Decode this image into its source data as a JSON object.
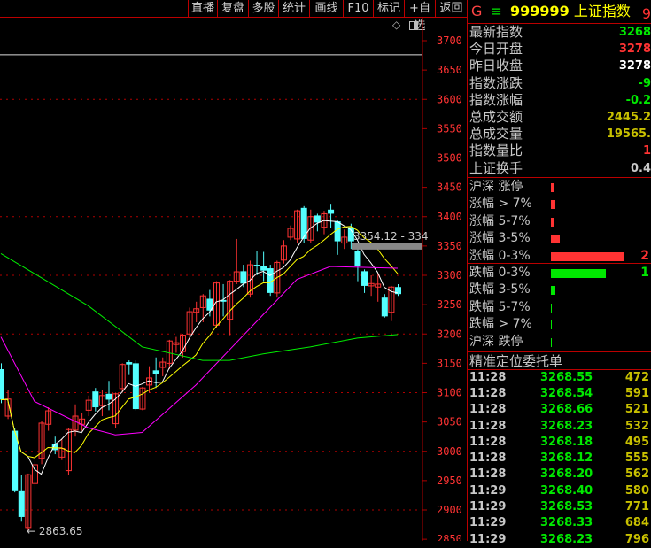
{
  "toolbar": {
    "buttons": [
      "直播",
      "复盘",
      "多股",
      "统计",
      "画线",
      "F10",
      "标记",
      "+自选",
      "返回"
    ]
  },
  "chart": {
    "price_axis": [
      "3700",
      "3650",
      "3600",
      "3550",
      "3500",
      "3450",
      "3400",
      "3350",
      "3300",
      "3250",
      "3200",
      "3150",
      "3100",
      "3050",
      "3000",
      "2950",
      "2900",
      "2850"
    ],
    "low_label": "2863.65",
    "range_label": "3354.12 - 334",
    "hline_price": 3676,
    "band_price": 3350,
    "colors": {
      "up": "#ff3333",
      "down": "#54ffff",
      "ma5": "#ffffff",
      "ma10": "#ffff00",
      "ma20": "#ff00ff",
      "ma60": "#00ee00",
      "grid": "#b00000"
    },
    "candles": [
      [
        3140,
        3150,
        3082,
        3088
      ],
      [
        3060,
        3105,
        3055,
        3089
      ],
      [
        3035,
        3040,
        2930,
        2932
      ],
      [
        2932,
        2960,
        2880,
        2888
      ],
      [
        2870,
        2962,
        2864,
        2960
      ],
      [
        2945,
        2985,
        2935,
        2977
      ],
      [
        2988,
        3052,
        2978,
        3048
      ],
      [
        3046,
        3075,
        3035,
        3069
      ],
      [
        3013,
        3025,
        2995,
        3002
      ],
      [
        2990,
        3020,
        2985,
        3005
      ],
      [
        2967,
        3040,
        2960,
        3037
      ],
      [
        3036,
        3080,
        3025,
        3060
      ],
      [
        3046,
        3065,
        3035,
        3055
      ],
      [
        3070,
        3095,
        3060,
        3087
      ],
      [
        3102,
        3108,
        3068,
        3075
      ],
      [
        3078,
        3105,
        3060,
        3095
      ],
      [
        3098,
        3120,
        3070,
        3088
      ],
      [
        3047,
        3100,
        3040,
        3098
      ],
      [
        3107,
        3150,
        3100,
        3148
      ],
      [
        3152,
        3155,
        3130,
        3148
      ],
      [
        3150,
        3155,
        3070,
        3072
      ],
      [
        3072,
        3110,
        3070,
        3108
      ],
      [
        3113,
        3145,
        3100,
        3125
      ],
      [
        3138,
        3160,
        3108,
        3132
      ],
      [
        3143,
        3160,
        3128,
        3152
      ],
      [
        3150,
        3190,
        3140,
        3188
      ],
      [
        3182,
        3195,
        3168,
        3185
      ],
      [
        3170,
        3200,
        3160,
        3198
      ],
      [
        3200,
        3245,
        3190,
        3238
      ],
      [
        3237,
        3255,
        3220,
        3243
      ],
      [
        3245,
        3268,
        3220,
        3265
      ],
      [
        3260,
        3275,
        3230,
        3240
      ],
      [
        3215,
        3290,
        3210,
        3287
      ],
      [
        3258,
        3285,
        3230,
        3255
      ],
      [
        3225,
        3292,
        3198,
        3290
      ],
      [
        3290,
        3362,
        3285,
        3306
      ],
      [
        3307,
        3318,
        3280,
        3286
      ],
      [
        3268,
        3325,
        3262,
        3318
      ],
      [
        3318,
        3342,
        3300,
        3316
      ],
      [
        3316,
        3340,
        3290,
        3308
      ],
      [
        3312,
        3318,
        3265,
        3270
      ],
      [
        3270,
        3325,
        3262,
        3322
      ],
      [
        3326,
        3360,
        3320,
        3350
      ],
      [
        3365,
        3385,
        3360,
        3380
      ],
      [
        3362,
        3412,
        3355,
        3410
      ],
      [
        3415,
        3418,
        3355,
        3362
      ],
      [
        3360,
        3412,
        3355,
        3400
      ],
      [
        3402,
        3405,
        3375,
        3390
      ],
      [
        3382,
        3410,
        3370,
        3405
      ],
      [
        3412,
        3422,
        3380,
        3405
      ],
      [
        3392,
        3395,
        3335,
        3358
      ],
      [
        3355,
        3378,
        3345,
        3365
      ],
      [
        3382,
        3388,
        3345,
        3358
      ],
      [
        3342,
        3345,
        3290,
        3316
      ],
      [
        3307,
        3310,
        3270,
        3282
      ],
      [
        3282,
        3300,
        3265,
        3286
      ],
      [
        3280,
        3302,
        3255,
        3285
      ],
      [
        3262,
        3268,
        3228,
        3230
      ],
      [
        3237,
        3282,
        3222,
        3280
      ],
      [
        3280,
        3285,
        3265,
        3268
      ]
    ],
    "ma20_points": [
      [
        0,
        3195
      ],
      [
        5,
        3085
      ],
      [
        13,
        3040
      ],
      [
        17,
        3028
      ],
      [
        21,
        3032
      ],
      [
        29,
        3113
      ],
      [
        39,
        3233
      ],
      [
        44,
        3293
      ],
      [
        49,
        3315
      ],
      [
        59,
        3312
      ]
    ],
    "ma60_points": [
      [
        0,
        3337
      ],
      [
        13,
        3248
      ],
      [
        21,
        3178
      ],
      [
        30,
        3155
      ],
      [
        34,
        3155
      ],
      [
        39,
        3166
      ],
      [
        46,
        3178
      ],
      [
        53,
        3193
      ],
      [
        59,
        3199
      ]
    ]
  },
  "quote": {
    "market_flag": "G",
    "menu_icon": "≡",
    "code": "999999",
    "name": "上证指数",
    "cut_char": "9",
    "stats": [
      {
        "label": "最新指数",
        "value": "3268",
        "color": "#00e800"
      },
      {
        "label": "今日开盘",
        "value": "3278",
        "color": "#ff3333"
      },
      {
        "label": "昨日收盘",
        "value": "3278",
        "color": "#ffffff"
      },
      {
        "label": "指数涨跌",
        "value": "-9",
        "color": "#00e800"
      },
      {
        "label": "指数涨幅",
        "value": "-0.2",
        "color": "#00e800"
      },
      {
        "label": "总成交额",
        "value": "2445.2",
        "color": "#c8c000"
      },
      {
        "label": "总成交量",
        "value": "19565.",
        "color": "#c8c000"
      },
      {
        "label": "指数量比",
        "value": "1",
        "color": "#ff3333"
      },
      {
        "label": "上证换手",
        "value": "0.4",
        "color": "#c8c8c8"
      }
    ],
    "up_dist": [
      {
        "label": "沪深 涨停",
        "fill": 0.05,
        "count": ""
      },
      {
        "label": "涨幅 > 7%",
        "fill": 0.06,
        "count": ""
      },
      {
        "label": "涨幅 5-7%",
        "fill": 0.05,
        "count": ""
      },
      {
        "label": "涨幅 3-5%",
        "fill": 0.12,
        "count": ""
      },
      {
        "label": "涨幅 0-3%",
        "fill": 1.0,
        "count": "2"
      }
    ],
    "down_dist": [
      {
        "label": "跌幅 0-3%",
        "fill": 0.75,
        "count": "1"
      },
      {
        "label": "跌幅 3-5%",
        "fill": 0.06,
        "count": ""
      },
      {
        "label": "跌幅 5-7%",
        "fill": 0.01,
        "count": ""
      },
      {
        "label": "跌幅 > 7%",
        "fill": 0.01,
        "count": ""
      },
      {
        "label": "沪深 跌停",
        "fill": 0.01,
        "count": ""
      }
    ],
    "ticks_title": "精准定位委托单",
    "ticks": [
      [
        "11:28",
        "3268.55",
        "472"
      ],
      [
        "11:28",
        "3268.54",
        "591"
      ],
      [
        "11:28",
        "3268.66",
        "521"
      ],
      [
        "11:28",
        "3268.23",
        "532"
      ],
      [
        "11:28",
        "3268.18",
        "495"
      ],
      [
        "11:28",
        "3268.12",
        "555"
      ],
      [
        "11:28",
        "3268.20",
        "562"
      ],
      [
        "11:29",
        "3268.40",
        "580"
      ],
      [
        "11:29",
        "3268.53",
        "771"
      ],
      [
        "11:29",
        "3268.33",
        "684"
      ],
      [
        "11:29",
        "3268.23",
        "796"
      ]
    ]
  }
}
